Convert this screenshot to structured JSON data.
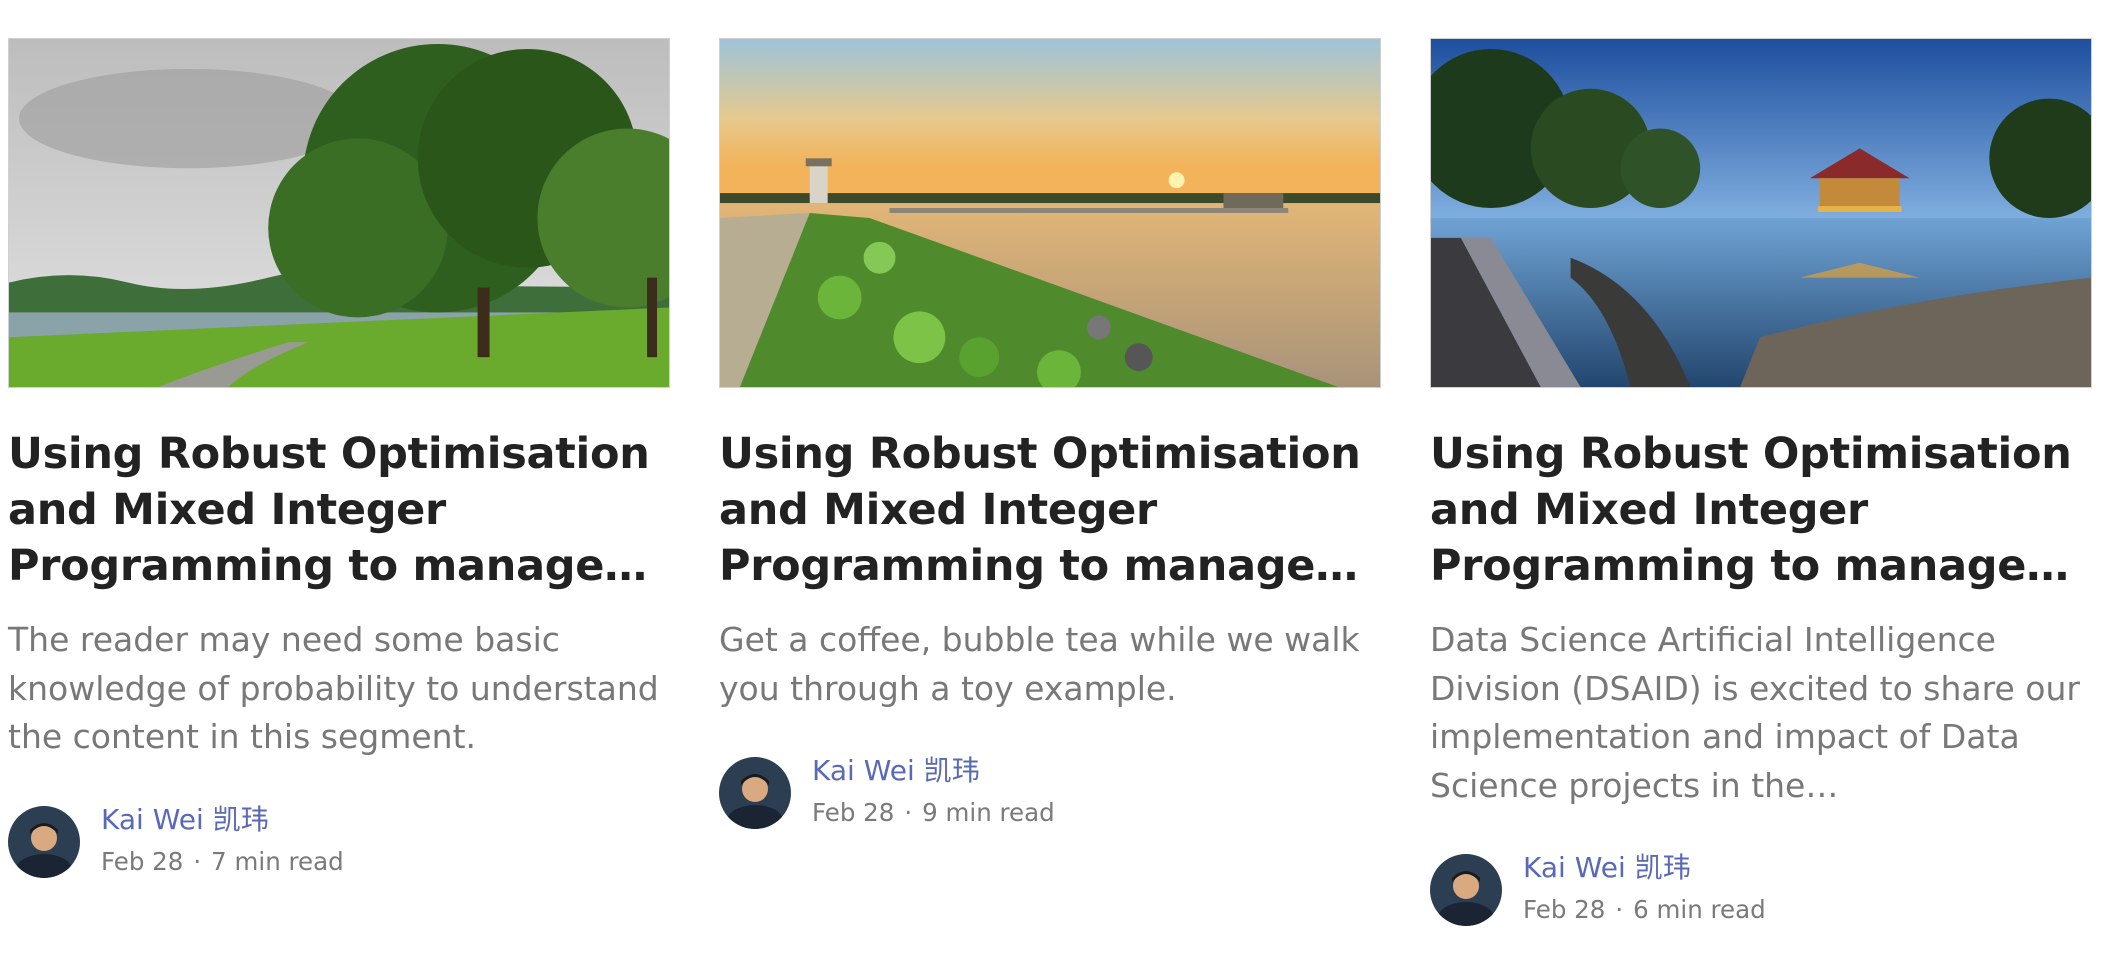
{
  "cards": [
    {
      "image": "park-lake-trees",
      "title_lines": [
        "Using Robust Optimisation",
        "and Mixed Integer",
        "Programming to manage…"
      ],
      "desc_lines": [
        "The reader may need some basic",
        "knowledge of probability to understand",
        "the content in this segment."
      ],
      "author": "Kai Wei 凯玮",
      "date": "Feb 28",
      "read_time": "7 min read"
    },
    {
      "image": "reservoir-sunset-pier",
      "title_lines": [
        "Using Robust Optimisation",
        "and Mixed Integer",
        "Programming to manage…"
      ],
      "desc_lines": [
        "Get a coffee, bubble tea while we walk",
        "you through a toy example."
      ],
      "author": "Kai Wei 凯玮",
      "date": "Feb 28",
      "read_time": "9 min read"
    },
    {
      "image": "pavilion-boardwalk-dusk",
      "title_lines": [
        "Using Robust Optimisation",
        "and Mixed Integer",
        "Programming to manage…"
      ],
      "desc_lines": [
        "Data Science Artificial Intelligence",
        "Division (DSAID) is excited to share our",
        "implementation and impact of Data",
        "Science projects in the…"
      ],
      "author": "Kai Wei 凯玮",
      "date": "Feb 28",
      "read_time": "6 min read"
    }
  ],
  "separator": "·",
  "colors": {
    "title": "#222222",
    "description": "#787878",
    "author_link": "#5a69b6",
    "meta": "#7a7a7a"
  }
}
